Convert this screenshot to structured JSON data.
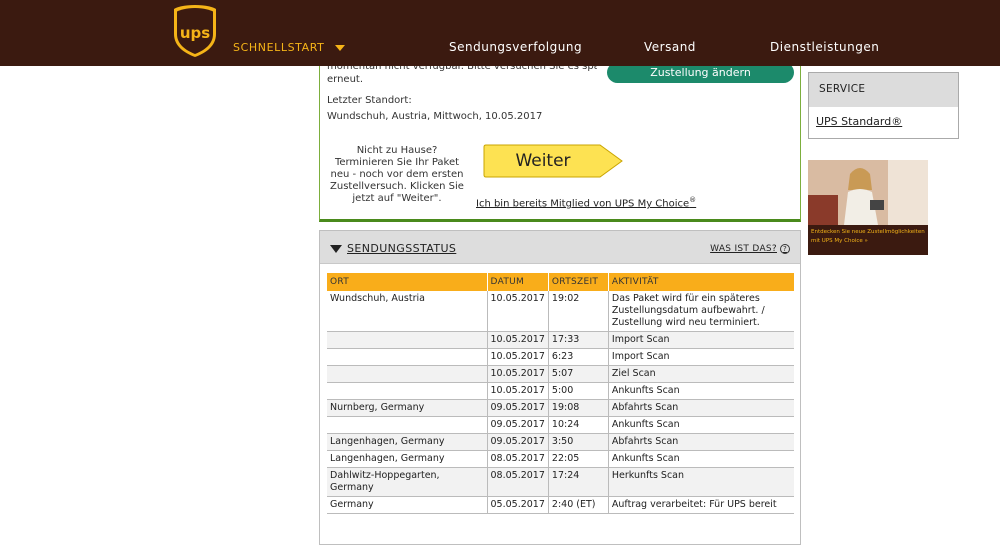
{
  "header": {
    "quickstart": "SCHNELLSTART",
    "nav": [
      "Sendungsverfolgung",
      "Versand",
      "Dienstleistungen"
    ]
  },
  "top": {
    "cut_text_line1": "momentan nicht verfügbar. Bitte versuchen Sie es später",
    "cut_text_line2": "erneut.",
    "change_button": "Zustellung ändern",
    "location_label": "Letzter Standort:",
    "location_value": "Wundschuh, Austria, Mittwoch, 10.05.2017",
    "not_home_text": "Nicht zu Hause? Terminieren Sie Ihr Paket neu - noch vor dem ersten Zustellversuch. Klicken Sie jetzt auf \"Weiter\".",
    "weiter": "Weiter",
    "mychoice_link": "Ich bin bereits Mitglied von UPS My Choice",
    "mychoice_reg": "®"
  },
  "status": {
    "title": "SENDUNGSSTATUS",
    "whatis": "WAS IST DAS?",
    "columns": [
      "ORT",
      "DATUM",
      "ORTSZEIT",
      "AKTIVITÄT"
    ],
    "rows": [
      [
        "Wundschuh, Austria",
        "10.05.2017",
        "19:02",
        "Das Paket wird für ein späteres Zustellungsdatum aufbewahrt. / Zustellung wird neu terminiert."
      ],
      [
        "",
        "10.05.2017",
        "17:33",
        "Import Scan"
      ],
      [
        "",
        "10.05.2017",
        "6:23",
        "Import Scan"
      ],
      [
        "",
        "10.05.2017",
        "5:07",
        "Ziel Scan"
      ],
      [
        "",
        "10.05.2017",
        "5:00",
        "Ankunfts Scan"
      ],
      [
        "Nurnberg, Germany",
        "09.05.2017",
        "19:08",
        "Abfahrts Scan"
      ],
      [
        "",
        "09.05.2017",
        "10:24",
        "Ankunfts Scan"
      ],
      [
        "Langenhagen, Germany",
        "09.05.2017",
        "3:50",
        "Abfahrts Scan"
      ],
      [
        "Langenhagen, Germany",
        "08.05.2017",
        "22:05",
        "Ankunfts Scan"
      ],
      [
        "Dahlwitz-Hoppegarten, Germany",
        "08.05.2017",
        "17:24",
        "Herkunfts Scan"
      ],
      [
        "Germany",
        "05.05.2017",
        "2:40 (ET)",
        "Auftrag verarbeitet: Für UPS bereit"
      ]
    ]
  },
  "service": {
    "head": "SERVICE",
    "link": "UPS Standard®"
  },
  "promo": {
    "text": "Entdecken Sie neue Zustellmöglichkeiten mit UPS My Choice »"
  },
  "colors": {
    "header_bg": "#3b1a10",
    "accent": "#f5b418",
    "green": "#1c8a6b",
    "table_head": "#f9ad1a"
  }
}
